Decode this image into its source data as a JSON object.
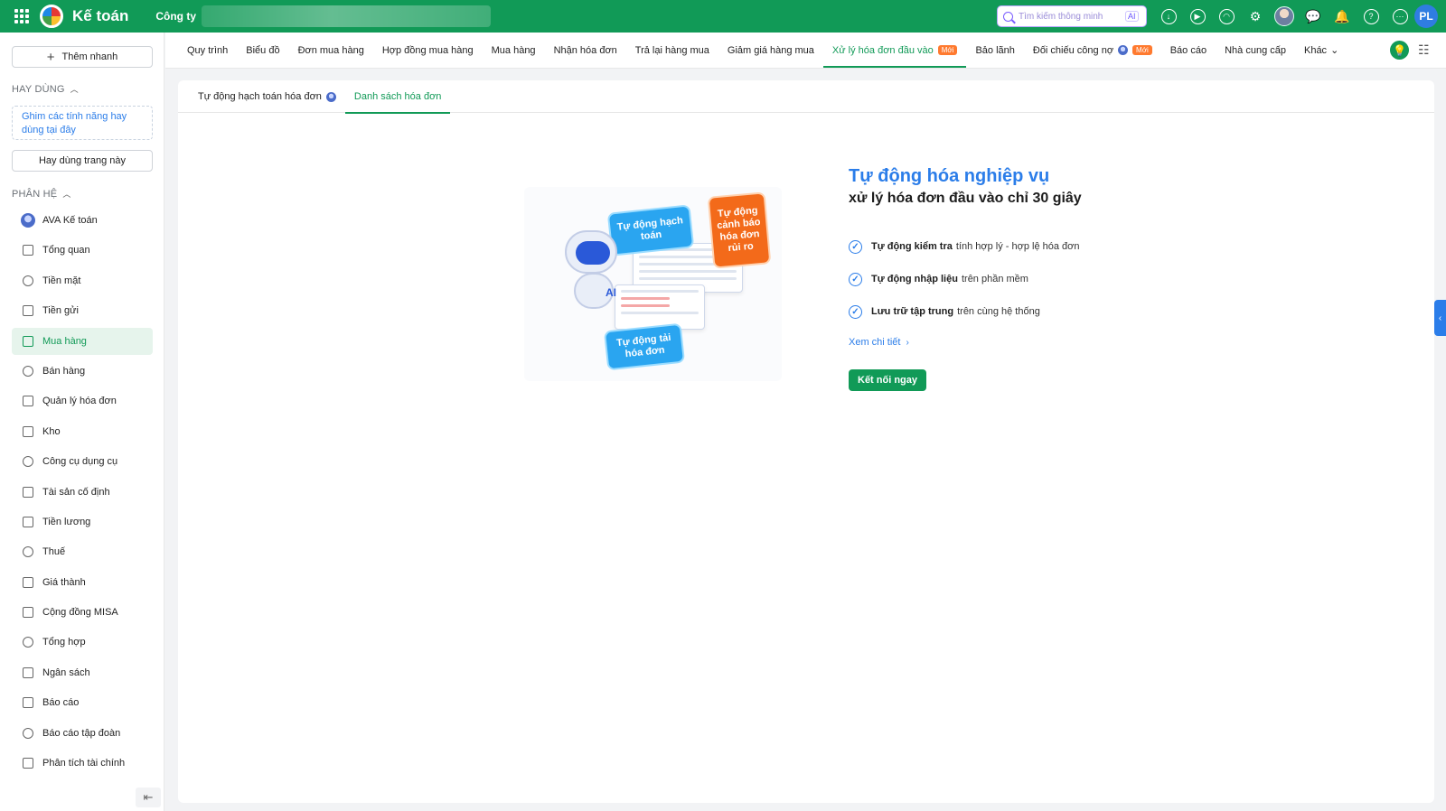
{
  "app": {
    "title": "Kế toán",
    "company_label": "Công ty"
  },
  "topbar": {
    "search_placeholder": "Tìm kiếm thông minh",
    "ai_badge": "AI",
    "user_initials": "PL",
    "icons": [
      "download-icon",
      "play-icon",
      "support-icon",
      "gear-icon",
      "avatar",
      "chat-icon",
      "bell-icon",
      "help-icon",
      "more-icon"
    ],
    "accent_color": "#119a57"
  },
  "sidebar": {
    "quick_add_label": "Thêm nhanh",
    "frequent_title": "HAY DÙNG",
    "pin_hint": "Ghim các tính năng hay dùng tại đây",
    "frequent_button": "Hay dùng trang này",
    "modules_title": "PHÂN HỆ",
    "items": [
      {
        "label": "AVA Kế toán",
        "icon": "ava-icon"
      },
      {
        "label": "Tổng quan",
        "icon": "dashboard-icon"
      },
      {
        "label": "Tiền mặt",
        "icon": "cash-icon"
      },
      {
        "label": "Tiền gửi",
        "icon": "bank-icon"
      },
      {
        "label": "Mua hàng",
        "icon": "shopping-bag-icon",
        "active": true
      },
      {
        "label": "Bán hàng",
        "icon": "cart-icon"
      },
      {
        "label": "Quản lý hóa đơn",
        "icon": "invoice-icon"
      },
      {
        "label": "Kho",
        "icon": "warehouse-icon"
      },
      {
        "label": "Công cụ dụng cụ",
        "icon": "tools-icon"
      },
      {
        "label": "Tài sản cố định",
        "icon": "truck-icon"
      },
      {
        "label": "Tiền lương",
        "icon": "salary-icon"
      },
      {
        "label": "Thuế",
        "icon": "tax-icon"
      },
      {
        "label": "Giá thành",
        "icon": "tag-icon"
      },
      {
        "label": "Cộng đồng MISA",
        "icon": "community-icon"
      },
      {
        "label": "Tổng hợp",
        "icon": "book-icon"
      },
      {
        "label": "Ngân sách",
        "icon": "budget-icon"
      },
      {
        "label": "Báo cáo",
        "icon": "bar-chart-icon"
      },
      {
        "label": "Báo cáo tập đoàn",
        "icon": "group-report-icon"
      },
      {
        "label": "Phân tích tài chính",
        "icon": "analysis-icon"
      }
    ],
    "collapse_icon": "collapse-icon"
  },
  "nav": {
    "tabs": [
      {
        "label": "Quy trình"
      },
      {
        "label": "Biểu đồ"
      },
      {
        "label": "Đơn mua hàng"
      },
      {
        "label": "Hợp đồng mua hàng"
      },
      {
        "label": "Mua hàng"
      },
      {
        "label": "Nhận hóa đơn"
      },
      {
        "label": "Trả lại hàng mua"
      },
      {
        "label": "Giảm giá hàng mua"
      },
      {
        "label": "Xử lý hóa đơn đầu vào",
        "badge": "Mới",
        "active": true
      },
      {
        "label": "Bảo lãnh"
      },
      {
        "label": "Đối chiếu công nợ",
        "badge": "Mới",
        "ava": true
      },
      {
        "label": "Báo cáo"
      },
      {
        "label": "Nhà cung cấp"
      },
      {
        "label": "Khác"
      }
    ]
  },
  "subtabs": [
    {
      "label": "Tự động hạch toán hóa đơn"
    },
    {
      "label": "Danh sách hóa đơn",
      "active": true
    }
  ],
  "illustration": {
    "card1": "Tự động hạch toán",
    "card2": "Tự động cảnh báo hóa đơn rủi ro",
    "card3": "Tự động tải hóa đơn",
    "robot_label": "AI"
  },
  "promo": {
    "title": "Tự động hóa nghiệp vụ",
    "subtitle": "xử lý hóa đơn đầu vào chỉ 30 giây",
    "features": [
      {
        "bold": "Tự động kiểm tra",
        "text": "tính hợp lý - hợp lệ hóa đơn"
      },
      {
        "bold": "Tự động nhập liệu",
        "text": "trên phần mềm"
      },
      {
        "bold": "Lưu trữ tập trung",
        "text": "trên cùng hệ thống"
      }
    ],
    "see_more": "Xem chi tiết",
    "connect_button": "Kết nối ngay"
  }
}
